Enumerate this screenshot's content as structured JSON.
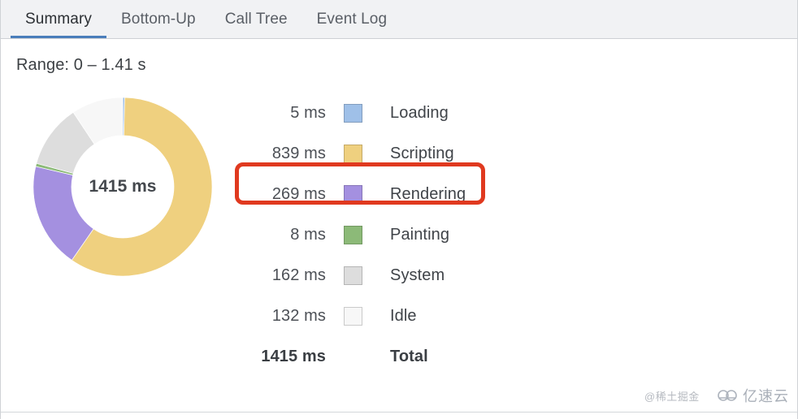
{
  "tabs": [
    {
      "label": "Summary",
      "active": true
    },
    {
      "label": "Bottom-Up",
      "active": false
    },
    {
      "label": "Call Tree",
      "active": false
    },
    {
      "label": "Event Log",
      "active": false
    }
  ],
  "range": {
    "text": "Range: 0 – 1.41 s"
  },
  "donut": {
    "center_label": "1415 ms"
  },
  "legend": {
    "rows": [
      {
        "value": "5 ms",
        "label": "Loading",
        "color": "#9fc0e8"
      },
      {
        "value": "839 ms",
        "label": "Scripting",
        "color": "#efd07f"
      },
      {
        "value": "269 ms",
        "label": "Rendering",
        "color": "#a490e0"
      },
      {
        "value": "8 ms",
        "label": "Painting",
        "color": "#8cba78"
      },
      {
        "value": "162 ms",
        "label": "System",
        "color": "#dddddd"
      },
      {
        "value": "132 ms",
        "label": "Idle",
        "color": "#f7f7f7"
      }
    ],
    "total": {
      "value": "1415 ms",
      "label": "Total"
    }
  },
  "annotation": {
    "color": "#e0391f",
    "target": "Rendering"
  },
  "watermarks": {
    "text": "@稀土掘金",
    "logo_name": "亿速云"
  },
  "chart_data": {
    "type": "pie",
    "title": "1415 ms",
    "categories": [
      "Loading",
      "Scripting",
      "Rendering",
      "Painting",
      "System",
      "Idle"
    ],
    "values": [
      5,
      839,
      269,
      8,
      162,
      132
    ],
    "unit": "ms",
    "total": 1415,
    "colors": [
      "#9fc0e8",
      "#efd07f",
      "#a490e0",
      "#8cba78",
      "#dddddd",
      "#f7f7f7"
    ],
    "legend_position": "right",
    "donut": true,
    "xlabel": "",
    "ylabel": ""
  }
}
